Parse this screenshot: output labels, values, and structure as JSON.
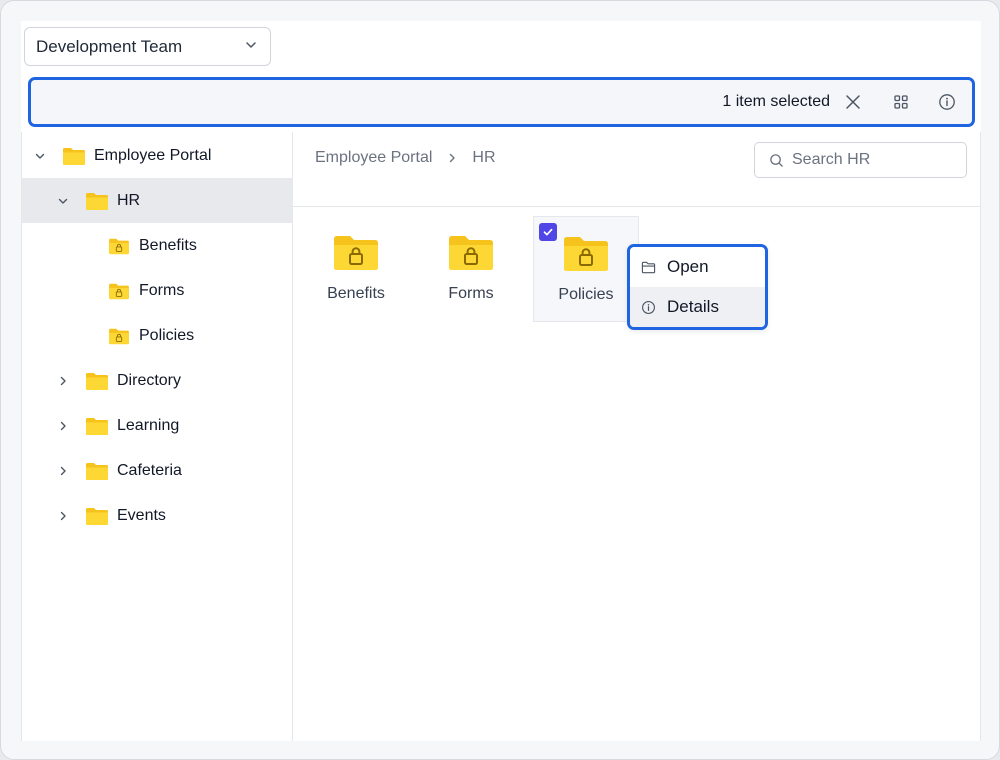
{
  "workspace": {
    "selected": "Development Team"
  },
  "toolbar": {
    "selection_text": "1 item selected"
  },
  "tree": [
    {
      "label": "Employee Portal",
      "expanded": true,
      "level": 0
    },
    {
      "label": "HR",
      "expanded": true,
      "level": 1,
      "active": true
    },
    {
      "label": "Benefits",
      "level": 2,
      "locked": true
    },
    {
      "label": "Forms",
      "level": 2,
      "locked": true
    },
    {
      "label": "Policies",
      "level": 2,
      "locked": true
    },
    {
      "label": "Directory",
      "level": 1,
      "expanded": false
    },
    {
      "label": "Learning",
      "level": 1,
      "expanded": false
    },
    {
      "label": "Cafeteria",
      "level": 1,
      "expanded": false
    },
    {
      "label": "Events",
      "level": 1,
      "expanded": false
    }
  ],
  "breadcrumb": [
    "Employee Portal",
    "HR"
  ],
  "search": {
    "placeholder": "Search HR"
  },
  "folders": [
    {
      "name": "Benefits",
      "selected": false
    },
    {
      "name": "Forms",
      "selected": false
    },
    {
      "name": "Policies",
      "selected": true
    }
  ],
  "context_menu": {
    "open_label": "Open",
    "details_label": "Details"
  },
  "colors": {
    "accent": "#1f64e0",
    "folder": "#fcd34d",
    "checkbox": "#4f46e5"
  }
}
